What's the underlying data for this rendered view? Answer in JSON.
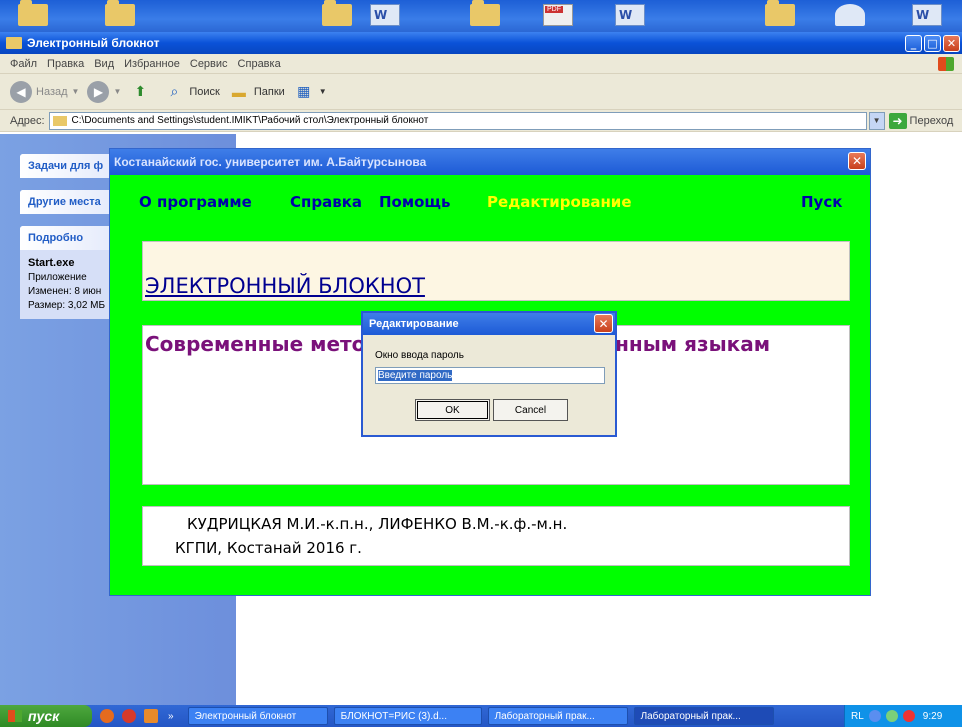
{
  "desktop": {
    "icons": [
      "folder-icon",
      "folder-icon",
      "folder-icon",
      "word-icon",
      "folder-icon",
      "pdf-icon",
      "word-icon",
      "folder-icon",
      "network-icon",
      "word-icon"
    ]
  },
  "explorer": {
    "title": "Электронный блокнот",
    "menu": [
      "Файл",
      "Правка",
      "Вид",
      "Избранное",
      "Сервис",
      "Справка"
    ],
    "toolbar": {
      "back": "Назад",
      "search": "Поиск",
      "folders": "Папки"
    },
    "address": {
      "label": "Адрес:",
      "path": "C:\\Documents and Settings\\student.IMIKT\\Рабочий стол\\Электронный блокнот",
      "go": "Переход"
    },
    "taskpane": {
      "box1": "Задачи для ф",
      "box2": "Другие места",
      "box3": "Подробно",
      "file_name": "Start.exe",
      "file_type": "Приложение",
      "modified": "Изменен: 8 июн",
      "size": "Размер: 3,02 МБ"
    }
  },
  "app": {
    "title": "Костанайский гос. университет им. А.Байтурсынова",
    "menu": {
      "about": "О программе",
      "help": "Справка",
      "assist": "Помощь",
      "edit": "Редактирование",
      "start": "Пуск"
    },
    "heading": "ЭЛЕКТРОННЫЙ БЛОКНОТ",
    "subtitle": "Современные методы обучения иностранным языкам",
    "author_line1": "КУДРИЦКАЯ М.И.-к.п.н., ЛИФЕНКО В.М.-к.ф.-м.н.",
    "author_line2": "КГПИ,  Костанай 2016 г."
  },
  "dialog": {
    "title": "Редактирование",
    "label": "Окно ввода пароль",
    "input_value": "Введите пароль",
    "ok": "OK",
    "cancel": "Cancel"
  },
  "taskbar": {
    "start": "пуск",
    "tasks": [
      "Электронный блокнот",
      "БЛОКНОТ=РИС (3).d...",
      "Лабораторный прак...",
      "Лабораторный прак..."
    ],
    "lang": "RL",
    "time": "9:29"
  }
}
